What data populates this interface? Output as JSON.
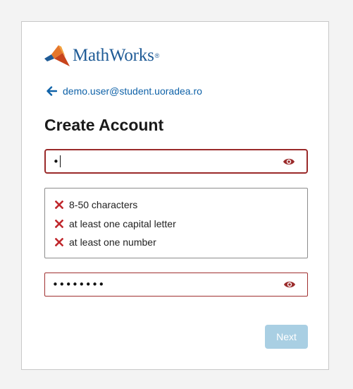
{
  "brand": {
    "name": "MathWorks",
    "reg_mark": "®",
    "logo_icon": "membrane-logo-icon"
  },
  "back": {
    "icon": "arrow-left-icon",
    "email": "demo.user@student.uoradea.ro"
  },
  "title": "Create Account",
  "password": {
    "value": "•",
    "eye_icon": "eye-icon"
  },
  "requirements": {
    "status_icon": "x-mark-icon",
    "status_color": "#c0282d",
    "items": [
      {
        "label": "8-50 characters"
      },
      {
        "label": "at least one capital letter"
      },
      {
        "label": "at least one number"
      }
    ]
  },
  "confirm_password": {
    "value": "••••••••",
    "eye_icon": "eye-icon"
  },
  "next_label": "Next",
  "colors": {
    "accent": "#0f62a8",
    "error": "#9a2a2a",
    "button_disabled": "#a9cfe3"
  }
}
